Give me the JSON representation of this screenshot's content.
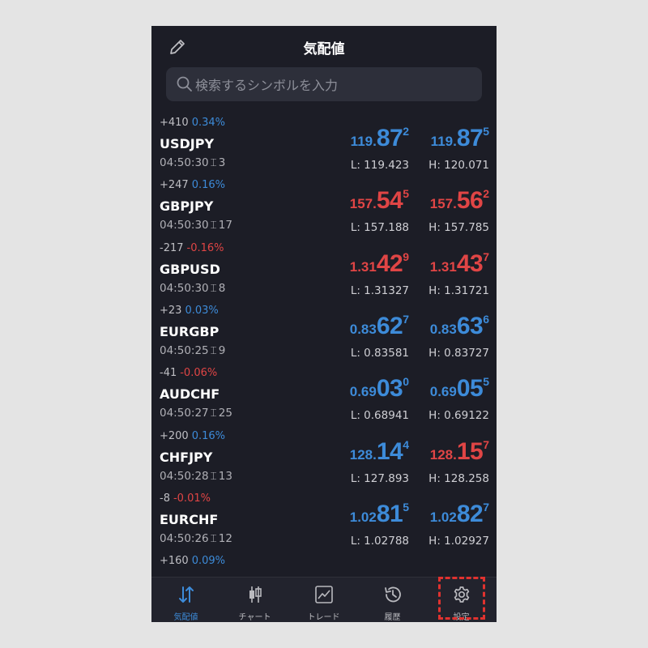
{
  "header": {
    "title": "気配値"
  },
  "search": {
    "placeholder": "検索するシンボルを入力"
  },
  "colors": {
    "up": "#3d8bd9",
    "down": "#e04545",
    "background": "#1c1d26",
    "highlight": "#e0322f"
  },
  "quotes": [
    {
      "change": "+410",
      "percent": "0.34%",
      "symbol": "USDJPY",
      "time": "04:50:30",
      "spread": "3",
      "direction": "up",
      "bid": {
        "small": "119.",
        "big": "87",
        "sup": "2"
      },
      "ask": {
        "small": "119.",
        "big": "87",
        "sup": "5"
      },
      "low": "L: 119.423",
      "high": "H: 120.071",
      "bid_color": "blue",
      "ask_color": "blue"
    },
    {
      "change": "+247",
      "percent": "0.16%",
      "symbol": "GBPJPY",
      "time": "04:50:30",
      "spread": "17",
      "direction": "up",
      "bid": {
        "small": "157.",
        "big": "54",
        "sup": "5"
      },
      "ask": {
        "small": "157.",
        "big": "56",
        "sup": "2"
      },
      "low": "L: 157.188",
      "high": "H: 157.785",
      "bid_color": "red",
      "ask_color": "red"
    },
    {
      "change": "-217",
      "percent": "-0.16%",
      "symbol": "GBPUSD",
      "time": "04:50:30",
      "spread": "8",
      "direction": "down",
      "bid": {
        "small": "1.31",
        "big": "42",
        "sup": "9"
      },
      "ask": {
        "small": "1.31",
        "big": "43",
        "sup": "7"
      },
      "low": "L: 1.31327",
      "high": "H: 1.31721",
      "bid_color": "red",
      "ask_color": "red"
    },
    {
      "change": "+23",
      "percent": "0.03%",
      "symbol": "EURGBP",
      "time": "04:50:25",
      "spread": "9",
      "direction": "up",
      "bid": {
        "small": "0.83",
        "big": "62",
        "sup": "7"
      },
      "ask": {
        "small": "0.83",
        "big": "63",
        "sup": "6"
      },
      "low": "L: 0.83581",
      "high": "H: 0.83727",
      "bid_color": "blue",
      "ask_color": "blue"
    },
    {
      "change": "-41",
      "percent": "-0.06%",
      "symbol": "AUDCHF",
      "time": "04:50:27",
      "spread": "25",
      "direction": "down",
      "bid": {
        "small": "0.69",
        "big": "03",
        "sup": "0"
      },
      "ask": {
        "small": "0.69",
        "big": "05",
        "sup": "5"
      },
      "low": "L: 0.68941",
      "high": "H: 0.69122",
      "bid_color": "blue",
      "ask_color": "blue"
    },
    {
      "change": "+200",
      "percent": "0.16%",
      "symbol": "CHFJPY",
      "time": "04:50:28",
      "spread": "13",
      "direction": "up",
      "bid": {
        "small": "128.",
        "big": "14",
        "sup": "4"
      },
      "ask": {
        "small": "128.",
        "big": "15",
        "sup": "7"
      },
      "low": "L: 127.893",
      "high": "H: 128.258",
      "bid_color": "blue",
      "ask_color": "red"
    },
    {
      "change": "-8",
      "percent": "-0.01%",
      "symbol": "EURCHF",
      "time": "04:50:26",
      "spread": "12",
      "direction": "down",
      "bid": {
        "small": "1.02",
        "big": "81",
        "sup": "5"
      },
      "ask": {
        "small": "1.02",
        "big": "82",
        "sup": "7"
      },
      "low": "L: 1.02788",
      "high": "H: 1.02927",
      "bid_color": "blue",
      "ask_color": "blue"
    },
    {
      "change": "+160",
      "percent": "0.09%",
      "direction": "up"
    }
  ],
  "tabs": [
    {
      "label": "気配値",
      "icon": "quotes-arrows-icon",
      "active": true
    },
    {
      "label": "チャート",
      "icon": "candlestick-chart-icon",
      "active": false
    },
    {
      "label": "トレード",
      "icon": "trade-chart-icon",
      "active": false
    },
    {
      "label": "履歴",
      "icon": "history-clock-icon",
      "active": false
    },
    {
      "label": "設定",
      "icon": "gear-icon",
      "active": false
    }
  ]
}
